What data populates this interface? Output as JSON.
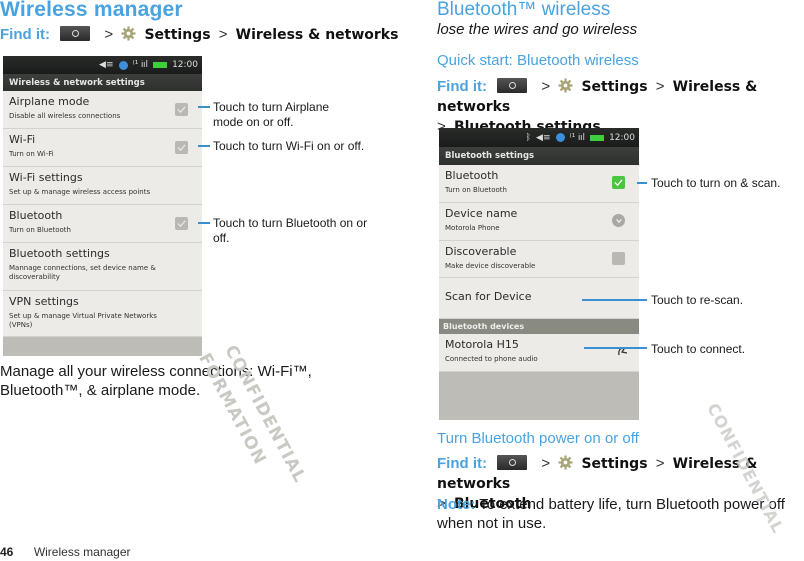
{
  "left": {
    "title": "Wireless manager",
    "find_it": {
      "label": "Find it:",
      "sep": ">",
      "path": [
        "Settings",
        "Wireless & networks"
      ]
    },
    "phone": {
      "clock": "12:00",
      "screen_title": "Wireless & network settings",
      "rows": [
        {
          "title": "Airplane mode",
          "subtitle": "Disable all wireless connections",
          "control": "checkbox",
          "checked": false
        },
        {
          "title": "Wi-Fi",
          "subtitle": "Turn on Wi-Fi",
          "control": "checkbox",
          "checked": false
        },
        {
          "title": "Wi-Fi settings",
          "subtitle": "Set up & manage wireless access points",
          "control": "none"
        },
        {
          "title": "Bluetooth",
          "subtitle": "Turn on Bluetooth",
          "control": "checkbox",
          "checked": false
        },
        {
          "title": "Bluetooth settings",
          "subtitle": "Mannage connections, set device name & discoverability",
          "control": "none"
        },
        {
          "title": "VPN settings",
          "subtitle": "Set up & manage Virtual Private Networks (VPNs)",
          "control": "none"
        }
      ]
    },
    "callouts": [
      "Touch to turn Airplane mode on or off.",
      "Touch to turn Wi-Fi on or off.",
      "Touch to turn Bluetooth on or off."
    ],
    "body": "Manage all your wireless connections: Wi-Fi™, Bluetooth™, & airplane mode."
  },
  "right": {
    "title": "Bluetooth™ wireless",
    "subtitle": "lose the wires and go wireless",
    "quick_start": "Quick start: Bluetooth wireless",
    "find_it_1": {
      "label": "Find it:",
      "sep": ">",
      "path": [
        "Settings",
        "Wireless & networks",
        "Bluetooth settings"
      ]
    },
    "phone": {
      "clock": "12:00",
      "screen_title": "Bluetooth settings",
      "rows": [
        {
          "title": "Bluetooth",
          "subtitle": "Turn on Bluetooth",
          "control": "checkbox",
          "checked": true
        },
        {
          "title": "Device name",
          "subtitle": "Motorola Phone",
          "control": "chevron"
        },
        {
          "title": "Discoverable",
          "subtitle": "Make device discoverable",
          "control": "checkbox",
          "checked": false
        },
        {
          "title": "Scan for Device",
          "subtitle": "",
          "control": "none"
        }
      ],
      "devices_header": "Bluetooth devices",
      "device": {
        "title": "Motorola H15",
        "subtitle": "Connected to phone audio",
        "icon": "headset-icon"
      }
    },
    "callouts": [
      "Touch to turn on & scan.",
      "Touch to re-scan.",
      "Touch to connect."
    ],
    "power_heading": "Turn Bluetooth power on or off",
    "find_it_2": {
      "label": "Find it:",
      "sep": ">",
      "path": [
        "Settings",
        "Wireless & networks",
        "Bluetooth"
      ]
    },
    "note_label": "Note:",
    "note_text": " To extend battery life, turn Bluetooth power off when not in use."
  },
  "watermark": {
    "line1": "CONFIDENTIAL",
    "line2": "FORMATION"
  },
  "footer": {
    "page_number": "46",
    "section": "Wireless manager"
  },
  "colors": {
    "accent": "#4aa3df",
    "leader": "#3a8fd0",
    "checkbox_on": "#4cc640"
  }
}
